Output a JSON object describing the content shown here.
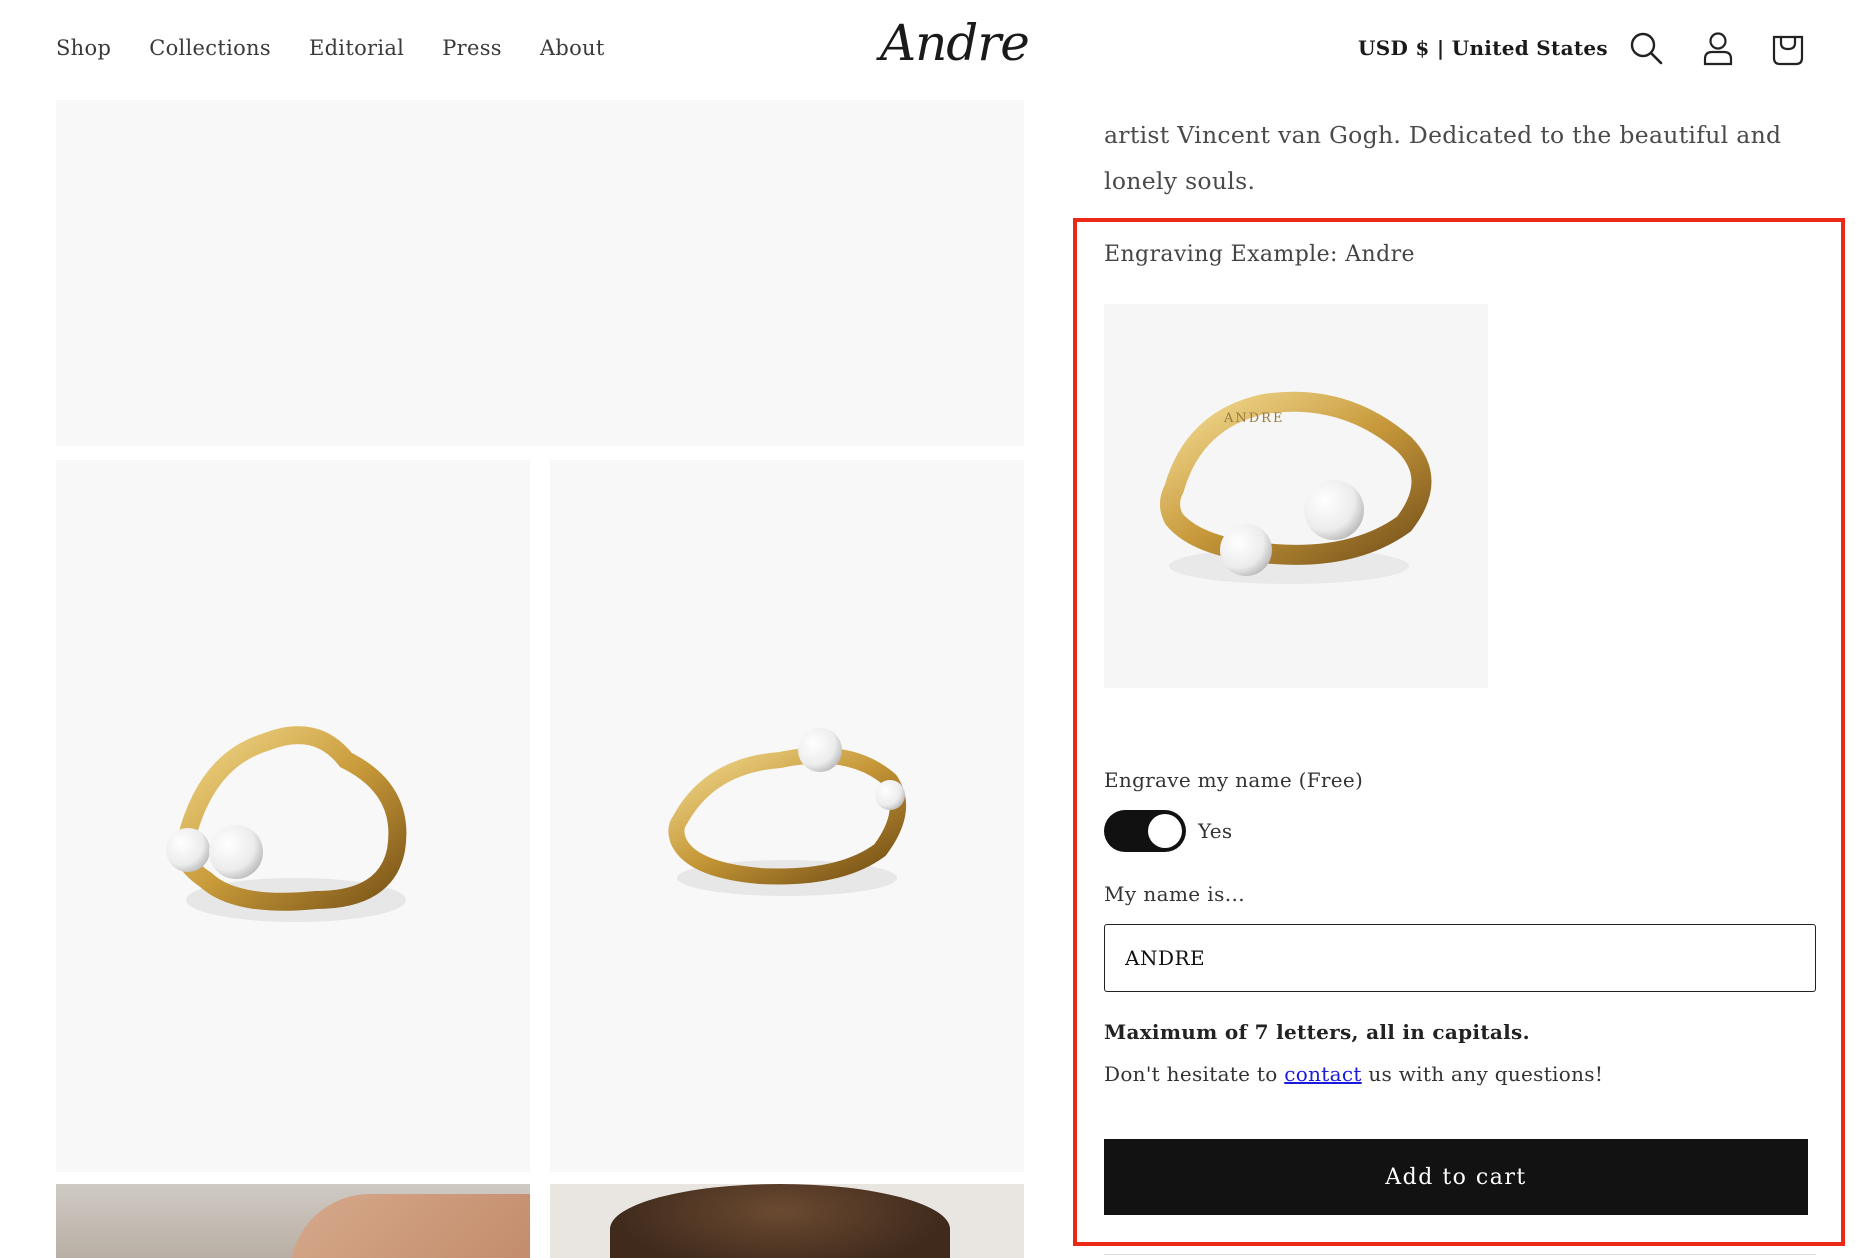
{
  "header": {
    "nav": [
      "Shop",
      "Collections",
      "Editorial",
      "Press",
      "About"
    ],
    "logo": "Andre",
    "locale": "USD $ | United States",
    "icons": [
      "search-icon",
      "account-icon",
      "cart-icon"
    ]
  },
  "product": {
    "description_tail": "artist Vincent van Gogh. Dedicated to the beautiful and lonely souls.",
    "engraving": {
      "example_label": "Engraving Example: Andre",
      "ring_engraving_text": "ANDRE",
      "toggle_label": "Engrave my name (Free)",
      "toggle_state": true,
      "toggle_text": "Yes",
      "name_label": "My name is...",
      "name_value": "ANDRE",
      "max_note": "Maximum of 7 letters, all in capitals.",
      "help_prefix": "Don't hesitate to ",
      "help_link": "contact",
      "help_suffix": " us with any questions!"
    },
    "add_to_cart": "Add to cart"
  },
  "colors": {
    "accent_button": "#121212",
    "highlight_border": "#ea2a16",
    "link": "#1a1adc",
    "gold": "#c9a24a"
  }
}
